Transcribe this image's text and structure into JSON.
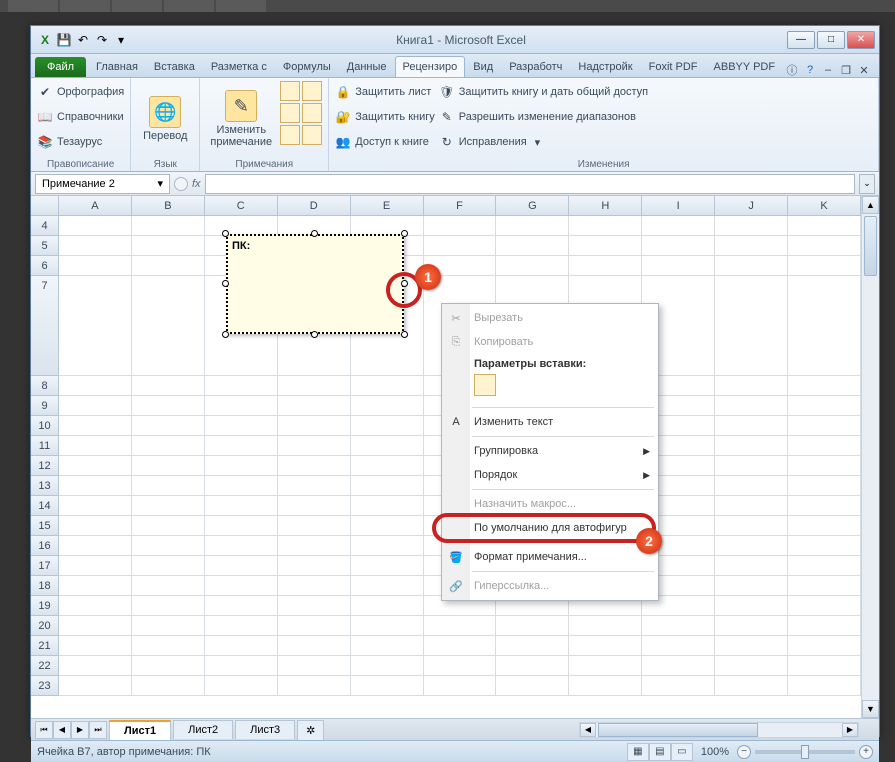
{
  "window": {
    "title": "Книга1 - Microsoft Excel"
  },
  "qat": {
    "excel": "X",
    "save": "💾",
    "undo": "↶",
    "redo": "↷"
  },
  "tabs": {
    "file": "Файл",
    "items": [
      "Главная",
      "Вставка",
      "Разметка с",
      "Формулы",
      "Данные",
      "Рецензиро",
      "Вид",
      "Разработч",
      "Надстройк",
      "Foxit PDF",
      "ABBYY PDF"
    ],
    "active_index": 5
  },
  "ribbon": {
    "proofing": {
      "label": "Правописание",
      "spelling": "Орфография",
      "research": "Справочники",
      "thesaurus": "Тезаурус"
    },
    "language": {
      "label": "Язык",
      "translate": "Перевод"
    },
    "comments": {
      "label": "Примечания",
      "edit": "Изменить примечание"
    },
    "changes": {
      "label": "Изменения",
      "protect_sheet": "Защитить лист",
      "protect_book": "Защитить книгу",
      "share_book": "Доступ к книге",
      "protect_share": "Защитить книгу и дать общий доступ",
      "allow_ranges": "Разрешить изменение диапазонов",
      "track": "Исправления"
    }
  },
  "namebox": {
    "value": "Примечание 2"
  },
  "columns": [
    "A",
    "B",
    "C",
    "D",
    "E",
    "F",
    "G",
    "H",
    "I",
    "J",
    "K"
  ],
  "rows": [
    "4",
    "5",
    "6",
    "7",
    "8",
    "9",
    "10",
    "11",
    "12",
    "13",
    "14",
    "15",
    "16",
    "17",
    "18",
    "19",
    "20",
    "21",
    "22",
    "23"
  ],
  "comment": {
    "author": "ПК:"
  },
  "context_menu": {
    "cut": "Вырезать",
    "copy": "Копировать",
    "paste_label": "Параметры вставки:",
    "edit_text": "Изменить текст",
    "grouping": "Группировка",
    "order": "Порядок",
    "assign_macro": "Назначить макрос...",
    "default_autoshape": "По умолчанию для автофигур",
    "format_comment": "Формат примечания...",
    "hyperlink": "Гиперссылка..."
  },
  "callouts": {
    "one": "1",
    "two": "2"
  },
  "sheets": {
    "s1": "Лист1",
    "s2": "Лист2",
    "s3": "Лист3"
  },
  "statusbar": {
    "text": "Ячейка B7, автор примечания: ПК",
    "zoom": "100%"
  }
}
